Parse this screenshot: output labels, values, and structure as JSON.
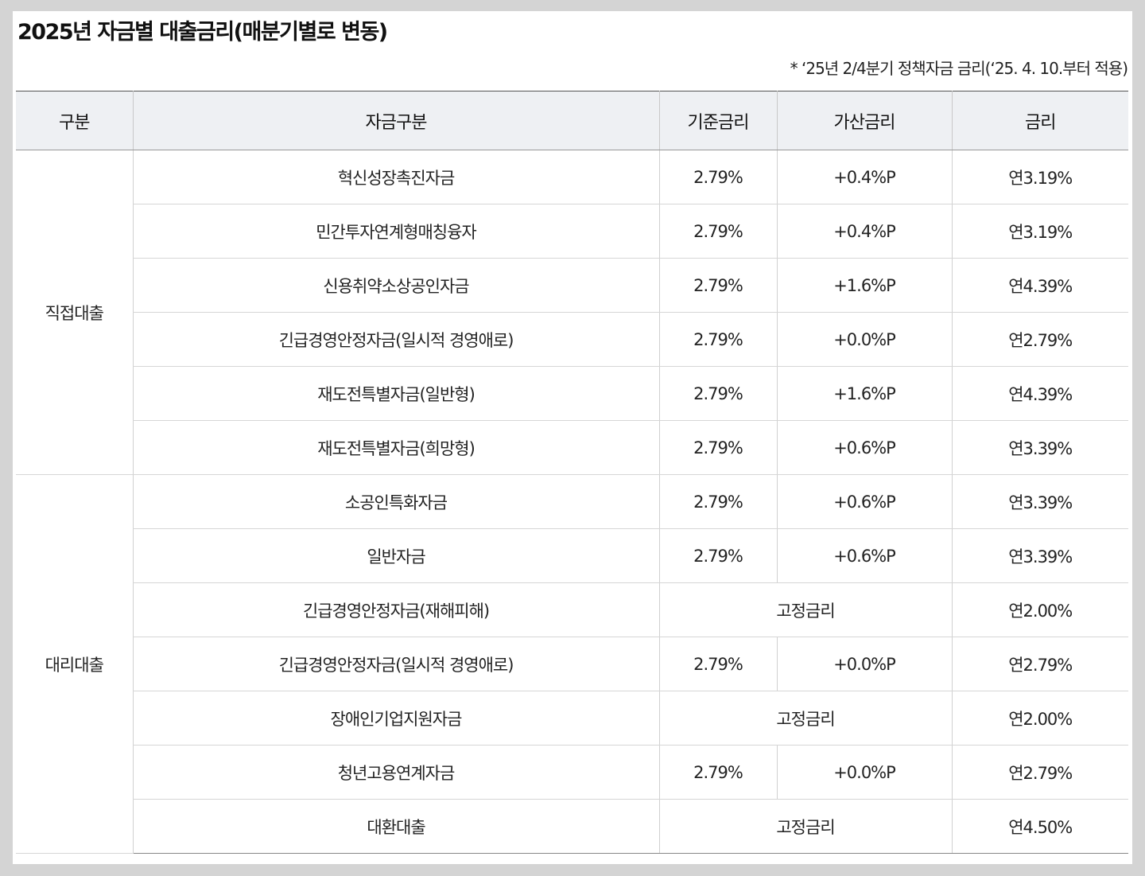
{
  "title": "2025년 자금별 대출금리(매분기별로 변동)",
  "note": "* ‘25년 2/4분기 정책자금 금리(‘25. 4. 10.부터 적용)",
  "headers": {
    "category": "구분",
    "fund_type": "자금구분",
    "base_rate": "기준금리",
    "add_rate": "가산금리",
    "rate": "금리"
  },
  "groups": [
    {
      "label": "직접대출",
      "rows": [
        {
          "fund": "혁신성장촉진자금",
          "base": "2.79%",
          "add": "+0.4%P",
          "rate": "연3.19%"
        },
        {
          "fund": "민간투자연계형매칭융자",
          "base": "2.79%",
          "add": "+0.4%P",
          "rate": "연3.19%"
        },
        {
          "fund": "신용취약소상공인자금",
          "base": "2.79%",
          "add": "+1.6%P",
          "rate": "연4.39%"
        },
        {
          "fund": "긴급경영안정자금(일시적 경영애로)",
          "base": "2.79%",
          "add": "+0.0%P",
          "rate": "연2.79%"
        },
        {
          "fund": "재도전특별자금(일반형)",
          "base": "2.79%",
          "add": "+1.6%P",
          "rate": "연4.39%"
        },
        {
          "fund": "재도전특별자금(희망형)",
          "base": "2.79%",
          "add": "+0.6%P",
          "rate": "연3.39%"
        }
      ]
    },
    {
      "label": "대리대출",
      "rows": [
        {
          "fund": "소공인특화자금",
          "base": "2.79%",
          "add": "+0.6%P",
          "rate": "연3.39%"
        },
        {
          "fund": "일반자금",
          "base": "2.79%",
          "add": "+0.6%P",
          "rate": "연3.39%"
        },
        {
          "fund": "긴급경영안정자금(재해피해)",
          "fixed": "고정금리",
          "rate": "연2.00%"
        },
        {
          "fund": "긴급경영안정자금(일시적 경영애로)",
          "base": "2.79%",
          "add": "+0.0%P",
          "rate": "연2.79%"
        },
        {
          "fund": "장애인기업지원자금",
          "fixed": "고정금리",
          "rate": "연2.00%"
        },
        {
          "fund": "청년고용연계자금",
          "base": "2.79%",
          "add": "+0.0%P",
          "rate": "연2.79%"
        },
        {
          "fund": "대환대출",
          "fixed": "고정금리",
          "rate": "연4.50%"
        }
      ]
    }
  ]
}
